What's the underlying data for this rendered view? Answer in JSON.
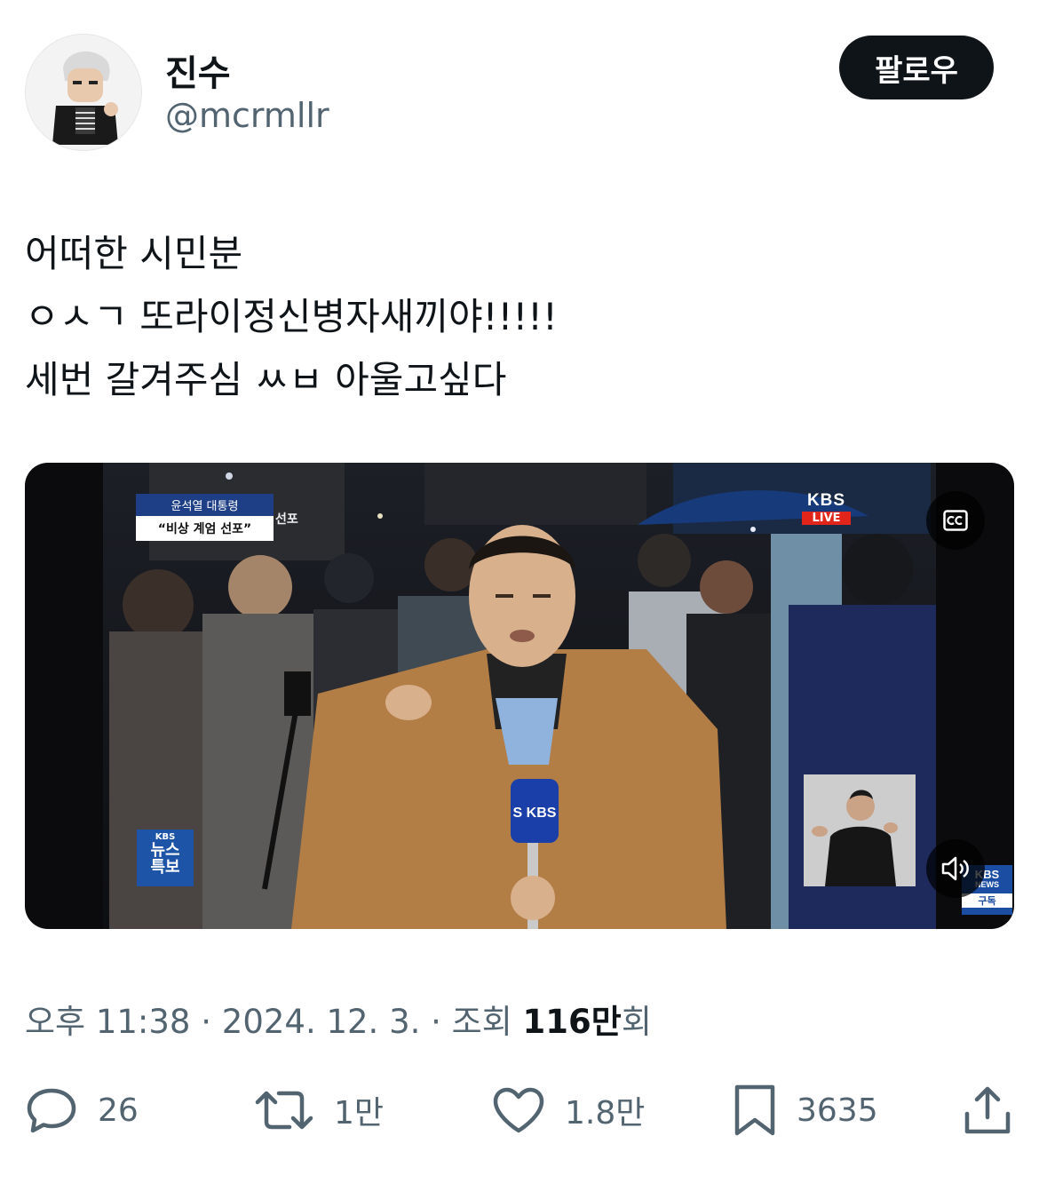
{
  "author": {
    "display_name": "진수",
    "handle": "@mcrmllr",
    "follow_label": "팔로우"
  },
  "tweet": {
    "lines": [
      "어떠한 시민분",
      "ㅇㅅㄱ 또라이정신병자새끼야!!!!!",
      "세번 갈겨주심 ㅆㅂ 아울고싶다"
    ]
  },
  "video": {
    "headline_top": "윤석열 대통령",
    "headline_main": "“비상 계엄 선포”",
    "headline_extra": "선포",
    "kbs_logo": "KBS",
    "live_label": "LIVE",
    "badge_small": "KBS",
    "badge_big_1": "뉴스",
    "badge_big_2": "특보",
    "mic_label": "S KBS",
    "kbs_news_a": "KBS",
    "kbs_news_b": "NEWS",
    "kbs_news_c": "구독",
    "icons": [
      "cc-icon",
      "volume-icon"
    ]
  },
  "meta": {
    "time": "오후 11:38",
    "date": "2024. 12. 3.",
    "views_prefix": "조회",
    "views_value": "116만",
    "views_suffix": "회",
    "separator": "·"
  },
  "actions": {
    "replies": "26",
    "reposts": "1만",
    "likes": "1.8만",
    "bookmarks": "3635"
  },
  "colors": {
    "text": "#0f1419",
    "secondary": "#536471",
    "follow_bg": "#0f1419",
    "kbs_blue": "#1e54a8",
    "live_red": "#e1251b"
  }
}
